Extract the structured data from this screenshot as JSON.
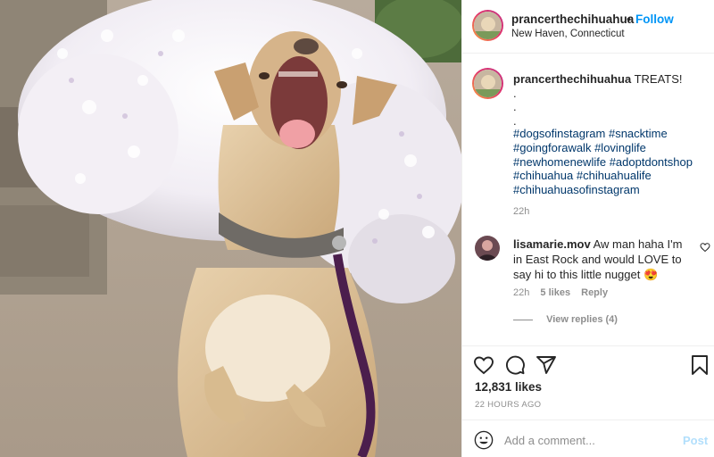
{
  "post": {
    "username": "prancerthechihuahua",
    "follow_label": "Follow",
    "dot": "•",
    "location": "New Haven, Connecticut",
    "photo_icon": "dog-photo"
  },
  "caption": {
    "username": "prancerthechihuahua",
    "text": "TREATS!",
    "dots": [
      ".",
      ".",
      "."
    ],
    "hashtags": [
      "#dogsofinstagram",
      "#snacktime",
      "#goingforawalk",
      "#lovinglife",
      "#newhomenewlife",
      "#adoptdontshop",
      "#chihuahua",
      "#chihuahualife",
      "#chihuahuasofinstagram"
    ],
    "time": "22h"
  },
  "comment": {
    "username": "lisamarie.mov",
    "text": "Aw man haha I'm in East Rock and would LOVE to say hi to this little nugget 😍",
    "time": "22h",
    "likes": "5 likes",
    "reply_label": "Reply",
    "view_replies": "View replies (4)",
    "heart_icon": "heart-outline-icon"
  },
  "actions": {
    "icons": [
      "heart-icon",
      "comment-icon",
      "share-icon",
      "bookmark-icon"
    ],
    "likes": "12,831 likes",
    "posted_ago": "22 HOURS AGO"
  },
  "add_comment": {
    "placeholder": "Add a comment...",
    "post_label": "Post",
    "emoji_icon": "smiley-icon"
  },
  "colors": {
    "accent": "#0095f6",
    "hashtag": "#00376b",
    "muted": "#8e8e8e",
    "post_disabled": "#b2dffc"
  }
}
